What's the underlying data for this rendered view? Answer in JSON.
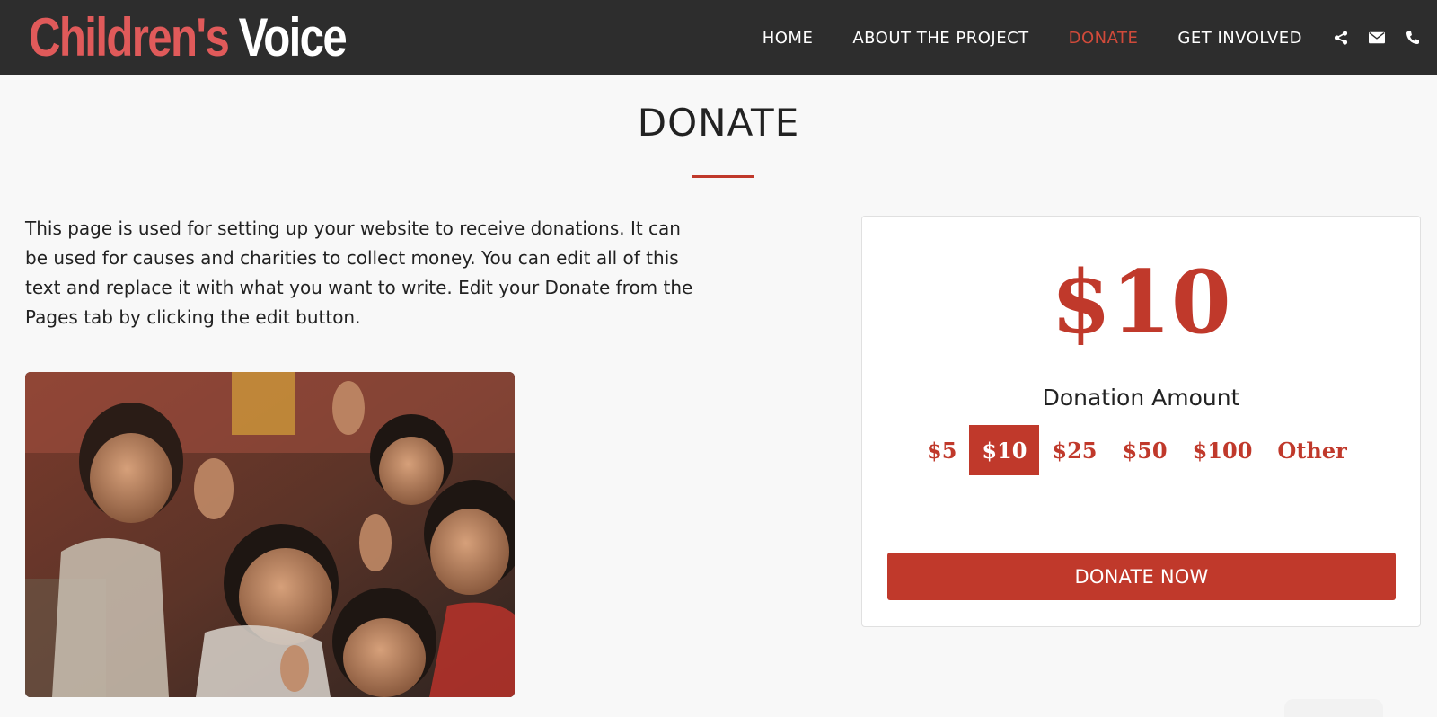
{
  "header": {
    "logo_part1": "Children's",
    "logo_part2": "Voice",
    "nav": [
      {
        "label": "HOME",
        "active": false
      },
      {
        "label": "ABOUT THE PROJECT",
        "active": false
      },
      {
        "label": "DONATE",
        "active": true
      },
      {
        "label": "GET INVOLVED",
        "active": false
      }
    ],
    "icons": [
      "share-icon",
      "envelope-icon",
      "phone-icon"
    ]
  },
  "page": {
    "title": "DONATE",
    "intro": "This page is used for setting up your website to receive donations. It can be used for causes and charities to collect money. You can edit all of this text and replace it with what you want to write. Edit your Donate from the Pages tab by clicking the edit button."
  },
  "donate_card": {
    "selected_amount": "$10",
    "label": "Donation Amount",
    "options": [
      {
        "label": "$5",
        "selected": false
      },
      {
        "label": "$10",
        "selected": true
      },
      {
        "label": "$25",
        "selected": false
      },
      {
        "label": "$50",
        "selected": false
      },
      {
        "label": "$100",
        "selected": false
      },
      {
        "label": "Other",
        "selected": false
      }
    ],
    "button_label": "DONATE NOW"
  },
  "colors": {
    "accent": "#c0392b",
    "header_bg": "#2d2d2d",
    "logo_red": "#e05a5a",
    "page_bg": "#f8f8f8"
  }
}
